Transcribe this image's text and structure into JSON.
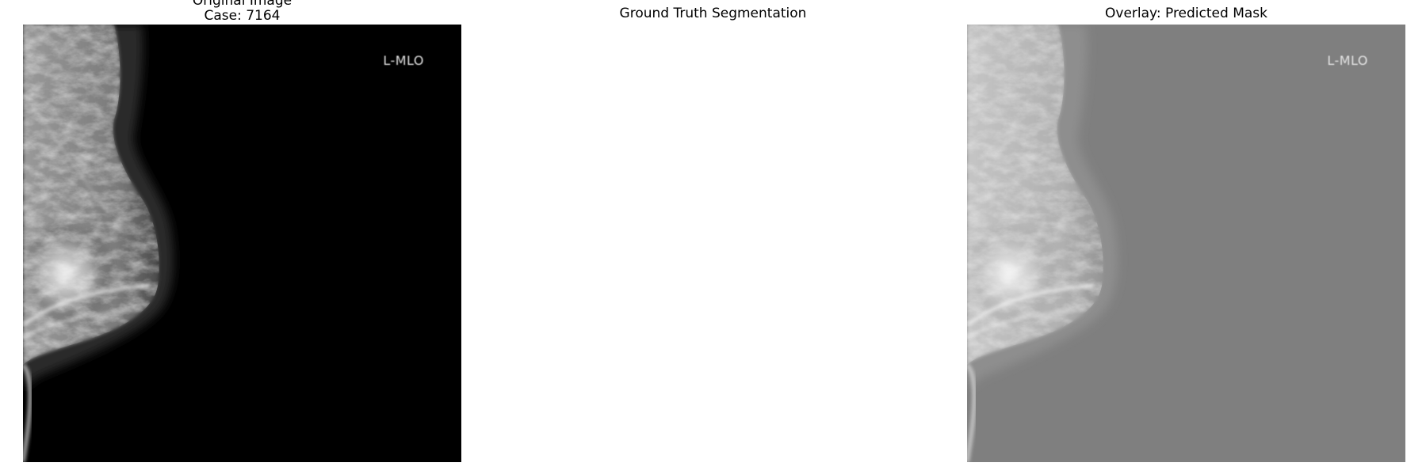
{
  "panels": [
    {
      "title_line1": "Original Image",
      "title_line2": "Case: 7164",
      "view_label": "L-MLO",
      "background": "#000000",
      "label_color": "#e0e0e0"
    },
    {
      "title_line1": "Ground Truth Segmentation",
      "background": "#ffffff"
    },
    {
      "title_line1": "Overlay: Predicted Mask",
      "view_label": "L-MLO",
      "background": "#7f7f7f",
      "label_color": "#e6e6e6"
    }
  ]
}
